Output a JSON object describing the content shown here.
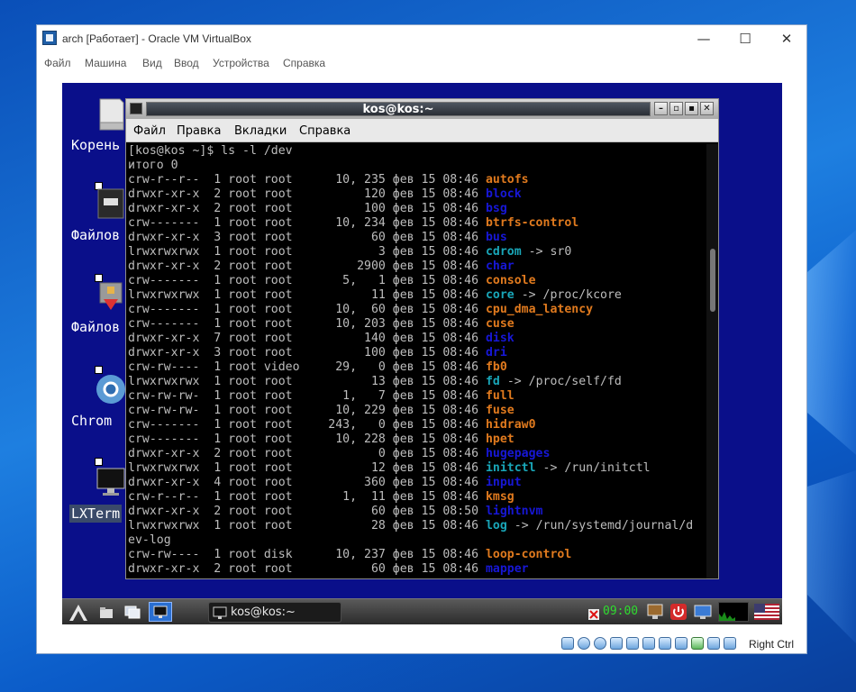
{
  "vbox": {
    "title": "arch [Работает] - Oracle VM VirtualBox",
    "controls": {
      "minimize": "—",
      "maximize": "☐",
      "close": "✕"
    },
    "menu": [
      "Файл",
      "Машина",
      "Вид",
      "Ввод",
      "Устройства",
      "Справка"
    ],
    "host_key": "Right Ctrl"
  },
  "desktop": {
    "icons": [
      "Корень",
      "Файлов",
      "Файлов",
      "Chrom",
      "LXTerm"
    ]
  },
  "terminal": {
    "title": "kos@kos:~",
    "buttons": [
      "–",
      "▫",
      "▪",
      "✕"
    ],
    "menu": [
      "Файл",
      "Правка",
      "Вкладки",
      "Справка"
    ],
    "lines": [
      {
        "t": "[kos@kos ~]$ ls -l /dev"
      },
      {
        "t": "итого 0"
      },
      {
        "t": "crw-r--r--  1 root root      10, 235 фев 15 08:46 ",
        "n": "autofs",
        "c": "dev"
      },
      {
        "t": "drwxr-xr-x  2 root root          120 фев 15 08:46 ",
        "n": "block",
        "c": "dir"
      },
      {
        "t": "drwxr-xr-x  2 root root          100 фев 15 08:46 ",
        "n": "bsg",
        "c": "dir"
      },
      {
        "t": "crw-------  1 root root      10, 234 фев 15 08:46 ",
        "n": "btrfs-control",
        "c": "dev"
      },
      {
        "t": "drwxr-xr-x  3 root root           60 фев 15 08:46 ",
        "n": "bus",
        "c": "dir"
      },
      {
        "t": "lrwxrwxrwx  1 root root            3 фев 15 08:46 ",
        "n": "cdrom",
        "c": "lnk",
        "r": " -> sr0"
      },
      {
        "t": "drwxr-xr-x  2 root root         2900 фев 15 08:46 ",
        "n": "char",
        "c": "dir"
      },
      {
        "t": "crw-------  1 root root       5,   1 фев 15 08:46 ",
        "n": "console",
        "c": "dev"
      },
      {
        "t": "lrwxrwxrwx  1 root root           11 фев 15 08:46 ",
        "n": "core",
        "c": "lnk",
        "r": " -> /proc/kcore"
      },
      {
        "t": "crw-------  1 root root      10,  60 фев 15 08:46 ",
        "n": "cpu_dma_latency",
        "c": "dev"
      },
      {
        "t": "crw-------  1 root root      10, 203 фев 15 08:46 ",
        "n": "cuse",
        "c": "dev"
      },
      {
        "t": "drwxr-xr-x  7 root root          140 фев 15 08:46 ",
        "n": "disk",
        "c": "dir"
      },
      {
        "t": "drwxr-xr-x  3 root root          100 фев 15 08:46 ",
        "n": "dri",
        "c": "dir"
      },
      {
        "t": "crw-rw----  1 root video     29,   0 фев 15 08:46 ",
        "n": "fb0",
        "c": "dev"
      },
      {
        "t": "lrwxrwxrwx  1 root root           13 фев 15 08:46 ",
        "n": "fd",
        "c": "lnk",
        "r": " -> /proc/self/fd"
      },
      {
        "t": "crw-rw-rw-  1 root root       1,   7 фев 15 08:46 ",
        "n": "full",
        "c": "dev"
      },
      {
        "t": "crw-rw-rw-  1 root root      10, 229 фев 15 08:46 ",
        "n": "fuse",
        "c": "dev"
      },
      {
        "t": "crw-------  1 root root     243,   0 фев 15 08:46 ",
        "n": "hidraw0",
        "c": "dev"
      },
      {
        "t": "crw-------  1 root root      10, 228 фев 15 08:46 ",
        "n": "hpet",
        "c": "dev"
      },
      {
        "t": "drwxr-xr-x  2 root root            0 фев 15 08:46 ",
        "n": "hugepages",
        "c": "dir"
      },
      {
        "t": "lrwxrwxrwx  1 root root           12 фев 15 08:46 ",
        "n": "initctl",
        "c": "lnk",
        "r": " -> /run/initctl"
      },
      {
        "t": "drwxr-xr-x  4 root root          360 фев 15 08:46 ",
        "n": "input",
        "c": "dir"
      },
      {
        "t": "crw-r--r--  1 root root       1,  11 фев 15 08:46 ",
        "n": "kmsg",
        "c": "dev"
      },
      {
        "t": "drwxr-xr-x  2 root root           60 фев 15 08:50 ",
        "n": "lightnvm",
        "c": "dir"
      },
      {
        "t": "lrwxrwxrwx  1 root root           28 фев 15 08:46 ",
        "n": "log",
        "c": "lnk",
        "r": " -> /run/systemd/journal/d"
      },
      {
        "t": "ev-log"
      },
      {
        "t": "crw-rw----  1 root disk      10, 237 фев 15 08:46 ",
        "n": "loop-control",
        "c": "dev"
      },
      {
        "t": "drwxr-xr-x  2 root root           60 фев 15 08:46 ",
        "n": "mapper",
        "c": "dir"
      }
    ]
  },
  "taskbar": {
    "task_label": "kos@kos:~",
    "clock": "09:00"
  },
  "colors": {
    "device": "#e07a1e",
    "directory": "#1717d6",
    "symlink": "#19a6b8"
  }
}
